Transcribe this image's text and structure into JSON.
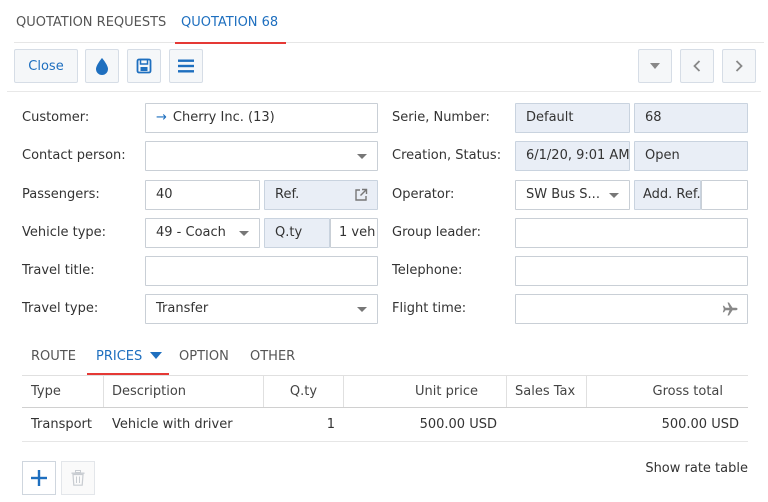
{
  "top_tabs": [
    {
      "label": "QUOTATION REQUESTS",
      "active": false
    },
    {
      "label": "QUOTATION 68",
      "active": true
    }
  ],
  "toolbar": {
    "close_label": "Close",
    "icons": [
      "drop-icon",
      "save-icon",
      "menu-icon",
      "caret-down-icon",
      "chevron-left-icon",
      "chevron-right-icon"
    ]
  },
  "form": {
    "customer_label": "Customer:",
    "customer_value": "Cherry Inc. (13)",
    "contact_label": "Contact person:",
    "contact_value": "",
    "passengers_label": "Passengers:",
    "passengers_value": "40",
    "ref_label": "Ref.",
    "vehicle_type_label": "Vehicle type:",
    "vehicle_type_value": "49 - Coach",
    "qty_label": "Q.ty",
    "qty_value": "1 veh",
    "travel_title_label": "Travel title:",
    "travel_title_value": "",
    "travel_type_label": "Travel type:",
    "travel_type_value": "Transfer",
    "serie_label": "Serie, Number:",
    "serie_value": "Default",
    "number_value": "68",
    "creation_label": "Creation, Status:",
    "creation_value": "6/1/20, 9:01 AM",
    "status_value": "Open",
    "operator_label": "Operator:",
    "operator_value": "SW Bus S...",
    "add_ref_label": "Add. Ref.",
    "add_ref_value": "",
    "group_leader_label": "Group leader:",
    "group_leader_value": "",
    "telephone_label": "Telephone:",
    "telephone_value": "",
    "flight_time_label": "Flight time:",
    "flight_time_value": ""
  },
  "sub_tabs": [
    {
      "label": "ROUTE",
      "active": false
    },
    {
      "label": "PRICES",
      "active": true
    },
    {
      "label": "OPTION",
      "active": false
    },
    {
      "label": "OTHER",
      "active": false
    }
  ],
  "grid": {
    "columns": [
      "Type",
      "Description",
      "Q.ty",
      "Unit price",
      "Sales Tax",
      "Gross total"
    ],
    "rows": [
      {
        "type": "Transport",
        "description": "Vehicle with driver",
        "qty": "1",
        "unit_price": "500.00 USD",
        "sales_tax": "",
        "gross_total": "500.00 USD"
      }
    ]
  },
  "footer": {
    "show_rate_table_label": "Show rate table"
  },
  "colors": {
    "accent": "#1e6fbf",
    "active_underline": "#e53935",
    "readonly_bg": "#e9eef6"
  }
}
